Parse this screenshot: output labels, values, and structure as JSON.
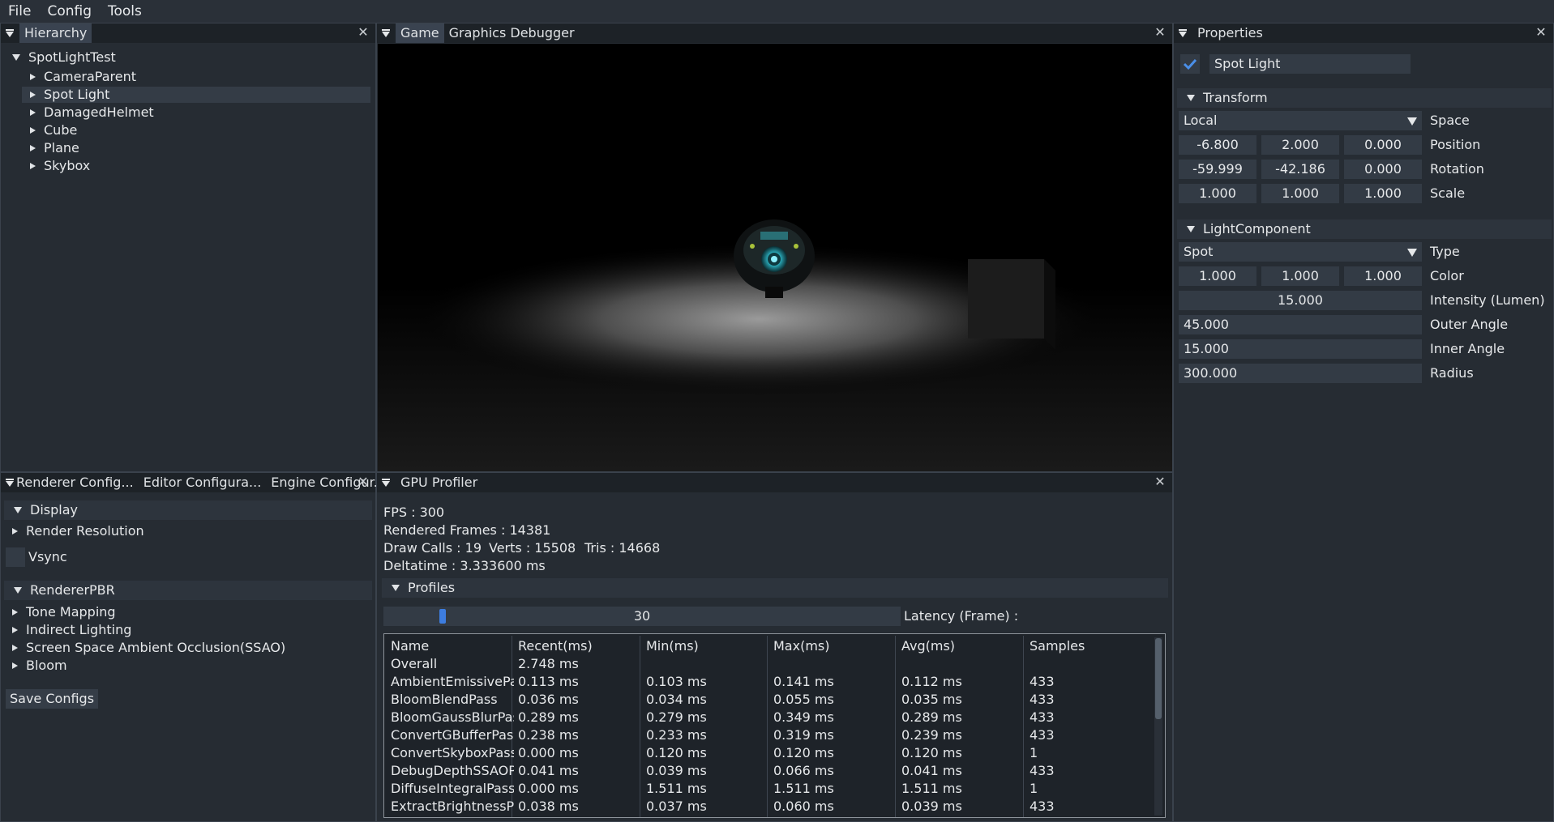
{
  "menu": [
    "File",
    "Config",
    "Tools"
  ],
  "hierarchy": {
    "tab": "Hierarchy",
    "root": "SpotLightTest",
    "children": [
      "CameraParent",
      "Spot Light",
      "DamagedHelmet",
      "Cube",
      "Plane",
      "Skybox"
    ],
    "selected_index": 1
  },
  "game": {
    "tabs": [
      "Game",
      "Graphics Debugger"
    ]
  },
  "properties": {
    "tab": "Properties",
    "object_name": "Spot Light",
    "transform": {
      "header": "Transform",
      "space_value": "Local",
      "space_label": "Space",
      "position": [
        "-6.800",
        "2.000",
        "0.000"
      ],
      "position_label": "Position",
      "rotation": [
        "-59.999",
        "-42.186",
        "0.000"
      ],
      "rotation_label": "Rotation",
      "scale": [
        "1.000",
        "1.000",
        "1.000"
      ],
      "scale_label": "Scale"
    },
    "light": {
      "header": "LightComponent",
      "type_value": "Spot",
      "type_label": "Type",
      "color": [
        "1.000",
        "1.000",
        "1.000"
      ],
      "color_label": "Color",
      "intensity": "15.000",
      "intensity_label": "Intensity (Lumen)",
      "outer_angle": "45.000",
      "outer_angle_label": "Outer Angle",
      "inner_angle": "15.000",
      "inner_angle_label": "Inner Angle",
      "radius": "300.000",
      "radius_label": "Radius"
    }
  },
  "config": {
    "tabs": [
      "Renderer Config...",
      "Editor Configura...",
      "Engine Configur..."
    ],
    "display_header": "Display",
    "render_resolution": "Render Resolution",
    "vsync": "Vsync",
    "renderer_header": "RendererPBR",
    "renderer_items": [
      "Tone Mapping",
      "Indirect Lighting",
      "Screen Space Ambient Occlusion(SSAO)",
      "Bloom"
    ],
    "save_button": "Save Configs"
  },
  "profiler": {
    "tab": "GPU Profiler",
    "fps": "FPS : 300",
    "rendered_frames": "Rendered Frames : 14381",
    "draw_calls": "Draw Calls : 19",
    "verts": "Verts : 15508",
    "tris": "Tris : 14668",
    "deltatime": "Deltatime : 3.333600 ms",
    "profiles_header": "Profiles",
    "slider_value": "30",
    "slider_fraction": 0.11,
    "latency_label": "Latency (Frame) :",
    "columns": [
      "Name",
      "Recent(ms)",
      "Min(ms)",
      "Max(ms)",
      "Avg(ms)",
      "Samples"
    ],
    "rows": [
      [
        "Overall",
        "2.748 ms",
        "",
        "",
        "",
        ""
      ],
      [
        "AmbientEmissivePass",
        "0.113 ms",
        "0.103 ms",
        "0.141 ms",
        "0.112 ms",
        "433"
      ],
      [
        "BloomBlendPass",
        "0.036 ms",
        "0.034 ms",
        "0.055 ms",
        "0.035 ms",
        "433"
      ],
      [
        "BloomGaussBlurPass",
        "0.289 ms",
        "0.279 ms",
        "0.349 ms",
        "0.289 ms",
        "433"
      ],
      [
        "ConvertGBufferPass",
        "0.238 ms",
        "0.233 ms",
        "0.319 ms",
        "0.239 ms",
        "433"
      ],
      [
        "ConvertSkyboxPass",
        "0.000 ms",
        "0.120 ms",
        "0.120 ms",
        "0.120 ms",
        "1"
      ],
      [
        "DebugDepthSSAOPass",
        "0.041 ms",
        "0.039 ms",
        "0.066 ms",
        "0.041 ms",
        "433"
      ],
      [
        "DiffuseIntegralPass",
        "0.000 ms",
        "1.511 ms",
        "1.511 ms",
        "1.511 ms",
        "1"
      ],
      [
        "ExtractBrightnessPass",
        "0.038 ms",
        "0.037 ms",
        "0.060 ms",
        "0.039 ms",
        "433"
      ]
    ]
  },
  "colors": {
    "accent": "#3d7de0",
    "panel": "#262c33",
    "field": "#333b45"
  }
}
